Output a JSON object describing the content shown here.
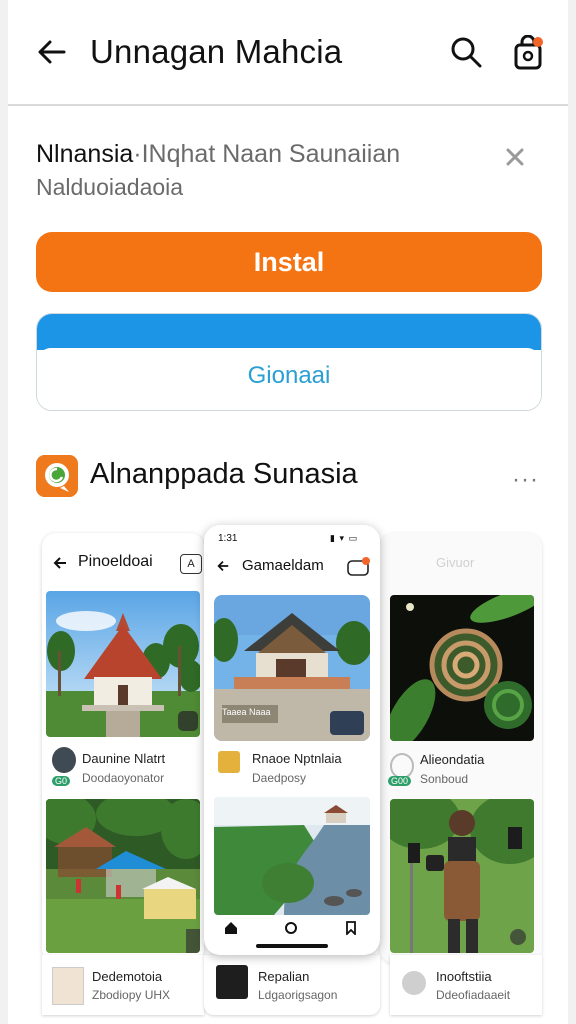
{
  "header": {
    "title": "Unnagan Mahcia",
    "back_icon": "arrow-left-icon",
    "search_icon": "search-icon",
    "bag_icon": "shopping-bag-icon"
  },
  "info": {
    "line1_bold": "Nlnansia",
    "line1_rest": "·INqhat Naan Saunaiian",
    "line2": "Nalduoiadaoia",
    "close_icon": "close-icon"
  },
  "buttons": {
    "install_label": "Instal",
    "open_label": "Gionaai"
  },
  "section": {
    "title": "Alnanppada Sunasia",
    "more": "···"
  },
  "screens": {
    "left": {
      "header": "Pinoeldoai",
      "badge": "A",
      "item1_title": "Daunine Nlatrt",
      "item1_sub": "Doodaoyonator",
      "item1_badge": "G0",
      "item2_title": "Dedemotoia",
      "item2_sub": "Zbodiopy UHX"
    },
    "mid": {
      "status_time": "1:31",
      "header": "Gamaeldam",
      "item1_title": "Rnaoe Nptnlaia",
      "item1_sub": "Daedposy",
      "item1_overlay": "Taaea Naaa",
      "item2_title": "Repalian",
      "item2_sub": "Ldgaorigsagon"
    },
    "right": {
      "header": "Givuor",
      "item1_title": "Alieondatia",
      "item1_sub": "Sonboud",
      "item1_badge": "G00",
      "item2_title": "Inooftstiia",
      "item2_sub": "Ddeofiadaaeit"
    }
  },
  "colors": {
    "install": "#f47414",
    "open_band": "#1c95e7",
    "open_text": "#2a9fd3",
    "app_logo": "#ef7a1d"
  }
}
